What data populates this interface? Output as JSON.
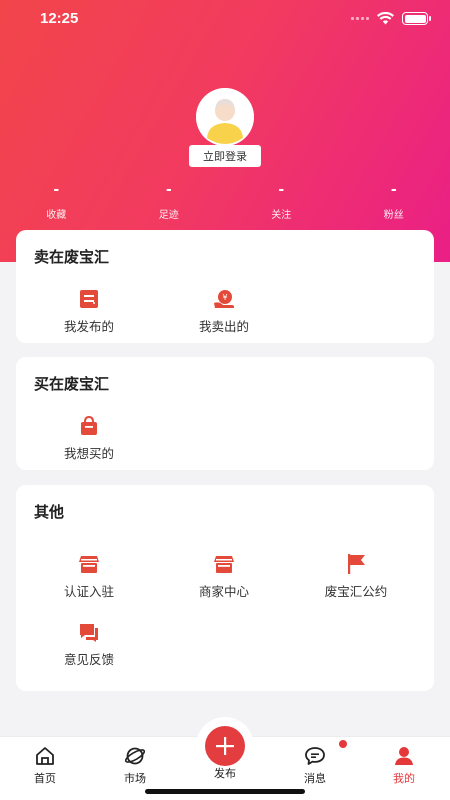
{
  "status_bar": {
    "time": "12:25"
  },
  "profile": {
    "login_label": "立即登录"
  },
  "stats": [
    {
      "value": "-",
      "label": "收藏"
    },
    {
      "value": "-",
      "label": "足迹"
    },
    {
      "value": "-",
      "label": "关注"
    },
    {
      "value": "-",
      "label": "粉丝"
    }
  ],
  "sell_section": {
    "title": "卖在废宝汇",
    "items": [
      {
        "label": "我发布的",
        "icon": "publish-list-icon"
      },
      {
        "label": "我卖出的",
        "icon": "sold-money-icon"
      }
    ]
  },
  "buy_section": {
    "title": "买在废宝汇",
    "items": [
      {
        "label": "我想买的",
        "icon": "shopping-bag-icon"
      }
    ]
  },
  "other_section": {
    "title": "其他",
    "items": [
      {
        "label": "认证入驻",
        "icon": "store-icon"
      },
      {
        "label": "商家中心",
        "icon": "merchant-store-icon"
      },
      {
        "label": "废宝汇公约",
        "icon": "flag-icon"
      },
      {
        "label": "意见反馈",
        "icon": "feedback-chat-icon"
      }
    ]
  },
  "tabbar": {
    "home": "首页",
    "market": "市场",
    "publish": "发布",
    "messages": "消息",
    "mine": "我的"
  },
  "colors": {
    "accent": "#e33d3f",
    "gradient_start": "#f2454a",
    "gradient_end": "#ea1f86"
  }
}
